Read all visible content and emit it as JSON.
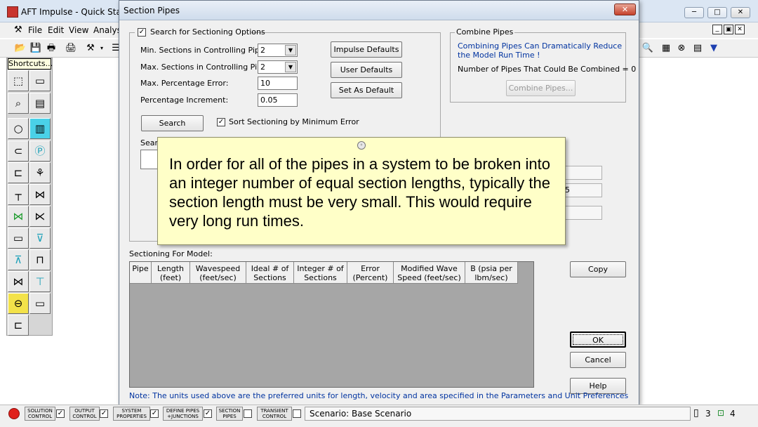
{
  "app": {
    "title": "AFT Impulse - Quick Start",
    "menu": [
      "File",
      "Edit",
      "View",
      "Analys"
    ],
    "shortcuts_label": "Shortcuts...",
    "window_controls": [
      "─",
      "□",
      "✕"
    ],
    "doc_controls": [
      "_",
      "▣",
      "✕"
    ]
  },
  "dialog": {
    "title": "Section Pipes",
    "close_glyph": "✕",
    "search_group": {
      "checkbox_label": "Search for Sectioning Options",
      "checked": true,
      "min_sections_label": "Min. Sections in Controlling Pipe:",
      "min_sections_value": "2",
      "max_sections_label": "Max. Sections in Controlling Pipe:",
      "max_sections_value": "2",
      "max_error_label": "Max. Percentage Error:",
      "max_error_value": "10",
      "increment_label": "Percentage Increment:",
      "increment_value": "0.05",
      "impulse_defaults": "Impulse Defaults",
      "user_defaults": "User Defaults",
      "set_as_default": "Set As Default",
      "search_button": "Search",
      "sort_label": "Sort Sectioning by Minimum Error",
      "sort_checked": true,
      "results_label": "Searc"
    },
    "combine_group": {
      "title": "Combine Pipes",
      "message": "Combining Pipes Can Dramatically Reduce the Model Run Time !",
      "count_text": "Number of Pipes That Could Be Combined = 0",
      "combine_button": "Combine Pipes..."
    },
    "partial_value": "5",
    "sectioning_label": "Sectioning For Model:",
    "table_headers": [
      "Pipe",
      "Length (feet)",
      "Wavespeed (feet/sec)",
      "Ideal # of Sections",
      "Integer # of Sections",
      "Error (Percent)",
      "Modified Wave Speed (feet/sec)",
      "B (psia per lbm/sec)"
    ],
    "copy_button": "Copy",
    "ok_button": "OK",
    "cancel_button": "Cancel",
    "help_button": "Help",
    "note": "Note: The units used above are the preferred units for length, velocity and area specified in the Parameters and Unit Preferences"
  },
  "tooltip": {
    "text": "In order for all of the pipes in a system to be broken into an integer number of equal section lengths, typically the section length must be very small. This would require very long run times."
  },
  "statusbar": {
    "buttons": [
      {
        "label": "SOLUTION CONTROL",
        "checked": true
      },
      {
        "label": "OUTPUT CONTROL",
        "checked": true
      },
      {
        "label": "SYSTEM PROPERTIES",
        "checked": true
      },
      {
        "label": "DEFINE PIPES +JUNCTIONS",
        "checked": true
      },
      {
        "label": "SECTION PIPES",
        "checked": false
      },
      {
        "label": "TRANSIENT CONTROL",
        "checked": false
      }
    ],
    "scenario": "Scenario: Base Scenario",
    "pipes_count": "3",
    "junctions_count": "4"
  },
  "colors": {
    "note_text": "#0033a0",
    "tooltip_bg": "#ffffc8",
    "status_red": "#e0201b"
  }
}
